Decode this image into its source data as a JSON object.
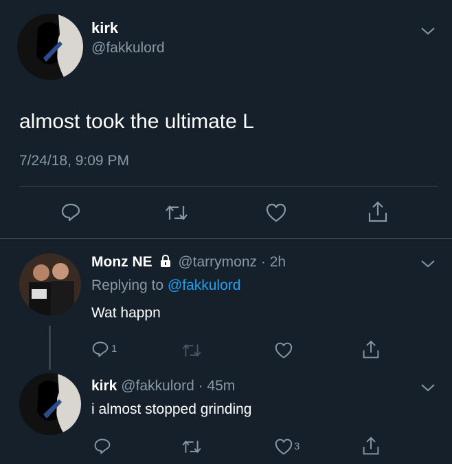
{
  "colors": {
    "background": "#15202b",
    "text": "#ffffff",
    "muted": "#8899a6",
    "link": "#1da1f2",
    "divider": "#38444d"
  },
  "main_tweet": {
    "display_name": "kirk",
    "handle": "@fakkulord",
    "text": "almost took the ultimate L",
    "timestamp": "7/24/18, 9:09 PM",
    "actions": [
      "reply-icon",
      "retweet-icon",
      "like-icon",
      "share-icon"
    ]
  },
  "reply_1": {
    "display_name": "Monz NE",
    "locked": true,
    "handle": "@tarrymonz",
    "separator": "·",
    "time": "2h",
    "replying_prefix": "Replying to",
    "replying_handle": "@fakkulord",
    "text": "Wat happn",
    "reply_count": "1",
    "like_count": ""
  },
  "reply_2": {
    "display_name": "kirk",
    "handle": "@fakkulord",
    "separator": "·",
    "time": "45m",
    "text": "i almost stopped grinding",
    "reply_count": "",
    "like_count": "3"
  }
}
